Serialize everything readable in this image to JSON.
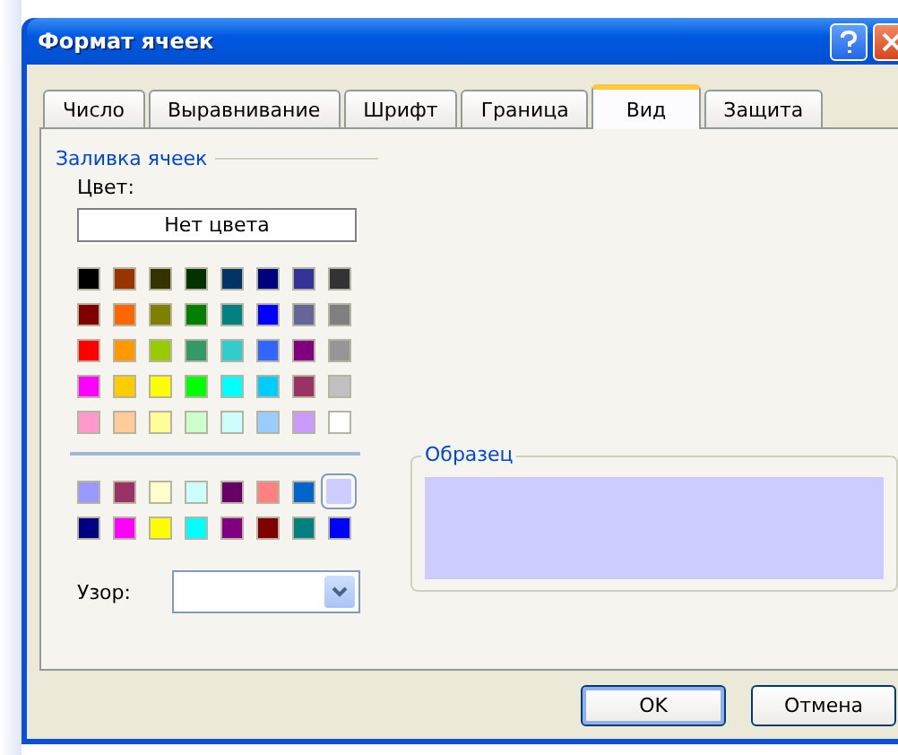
{
  "window": {
    "title": "Формат ячеек"
  },
  "tabs": [
    {
      "label": "Число",
      "selected": false
    },
    {
      "label": "Выравнивание",
      "selected": false
    },
    {
      "label": "Шрифт",
      "selected": false
    },
    {
      "label": "Граница",
      "selected": false
    },
    {
      "label": "Вид",
      "selected": true
    },
    {
      "label": "Защита",
      "selected": false
    }
  ],
  "fill_group": {
    "legend": "Заливка ячеек",
    "color_label": "Цвет:",
    "no_color_button": "Нет цвета",
    "palette": [
      {
        "color": "#000000",
        "selected": false
      },
      {
        "color": "#993300",
        "selected": false
      },
      {
        "color": "#333300",
        "selected": false
      },
      {
        "color": "#003300",
        "selected": false
      },
      {
        "color": "#003366",
        "selected": false
      },
      {
        "color": "#000080",
        "selected": false
      },
      {
        "color": "#333399",
        "selected": false
      },
      {
        "color": "#333333",
        "selected": false
      },
      {
        "color": "#800000",
        "selected": false
      },
      {
        "color": "#ff6600",
        "selected": false
      },
      {
        "color": "#808000",
        "selected": false
      },
      {
        "color": "#008000",
        "selected": false
      },
      {
        "color": "#008080",
        "selected": false
      },
      {
        "color": "#0000ff",
        "selected": false
      },
      {
        "color": "#666699",
        "selected": false
      },
      {
        "color": "#808080",
        "selected": false
      },
      {
        "color": "#ff0000",
        "selected": false
      },
      {
        "color": "#ff9900",
        "selected": false
      },
      {
        "color": "#99cc00",
        "selected": false
      },
      {
        "color": "#339966",
        "selected": false
      },
      {
        "color": "#33cccc",
        "selected": false
      },
      {
        "color": "#3366ff",
        "selected": false
      },
      {
        "color": "#800080",
        "selected": false
      },
      {
        "color": "#969696",
        "selected": false
      },
      {
        "color": "#ff00ff",
        "selected": false
      },
      {
        "color": "#ffcc00",
        "selected": false
      },
      {
        "color": "#ffff00",
        "selected": false
      },
      {
        "color": "#00ff00",
        "selected": false
      },
      {
        "color": "#00ffff",
        "selected": false
      },
      {
        "color": "#00ccff",
        "selected": false
      },
      {
        "color": "#993366",
        "selected": false
      },
      {
        "color": "#c0c0c0",
        "selected": false
      },
      {
        "color": "#ff99cc",
        "selected": false
      },
      {
        "color": "#ffcc99",
        "selected": false
      },
      {
        "color": "#ffff99",
        "selected": false
      },
      {
        "color": "#ccffcc",
        "selected": false
      },
      {
        "color": "#ccffff",
        "selected": false
      },
      {
        "color": "#99ccff",
        "selected": false
      },
      {
        "color": "#cc99ff",
        "selected": false
      },
      {
        "color": "#ffffff",
        "selected": false
      }
    ],
    "chart_palette": [
      {
        "color": "#9999ff",
        "selected": false
      },
      {
        "color": "#993366",
        "selected": false
      },
      {
        "color": "#ffffcc",
        "selected": false
      },
      {
        "color": "#ccffff",
        "selected": false
      },
      {
        "color": "#660066",
        "selected": false
      },
      {
        "color": "#ff8080",
        "selected": false
      },
      {
        "color": "#0066cc",
        "selected": false
      },
      {
        "color": "#ccccff",
        "selected": true
      },
      {
        "color": "#000080",
        "selected": false
      },
      {
        "color": "#ff00ff",
        "selected": false
      },
      {
        "color": "#ffff00",
        "selected": false
      },
      {
        "color": "#00ffff",
        "selected": false
      },
      {
        "color": "#800080",
        "selected": false
      },
      {
        "color": "#800000",
        "selected": false
      },
      {
        "color": "#008080",
        "selected": false
      },
      {
        "color": "#0000ff",
        "selected": false
      }
    ],
    "pattern_label": "Узор:"
  },
  "sample": {
    "legend": "Образец"
  },
  "buttons": [
    {
      "label": "OK",
      "default": true
    },
    {
      "label": "Отмена",
      "default": false
    }
  ]
}
